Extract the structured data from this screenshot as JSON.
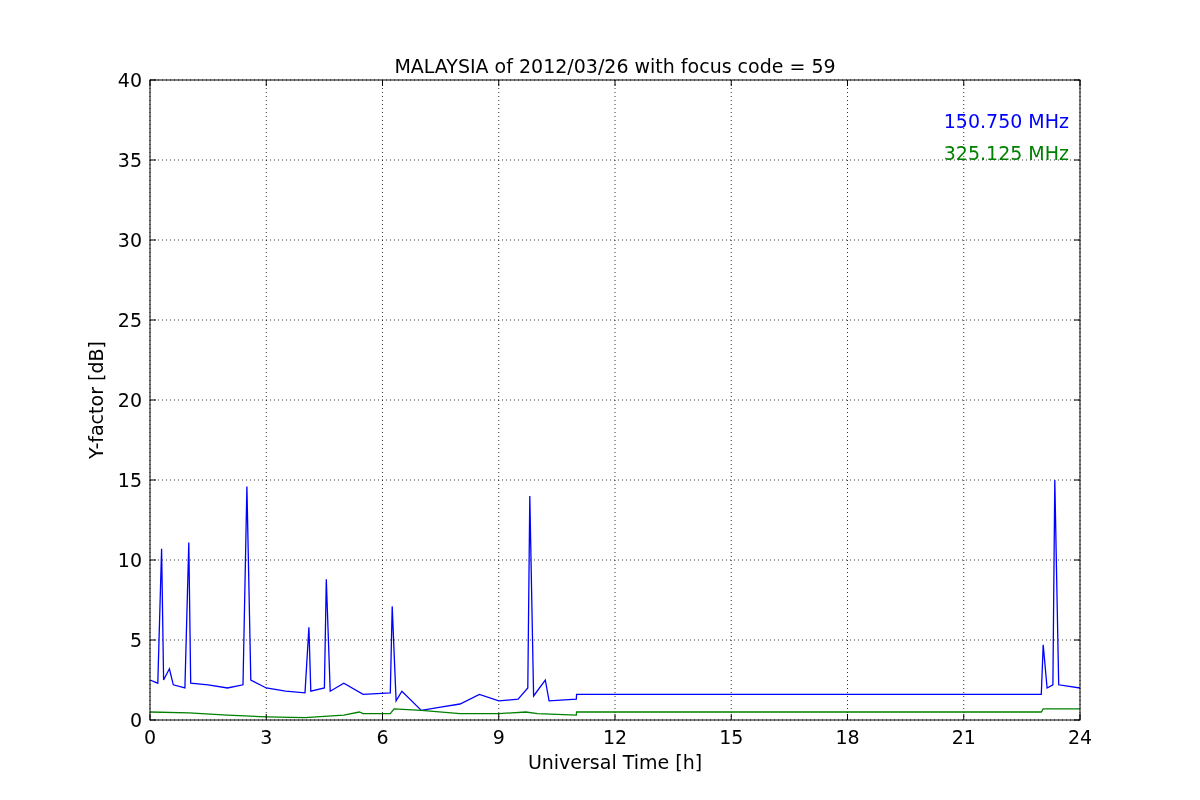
{
  "chart_data": {
    "type": "line",
    "title": "MALAYSIA of 2012/03/26 with focus code = 59",
    "xlabel": "Universal Time [h]",
    "ylabel": "Y-factor [dB]",
    "xlim": [
      0,
      24
    ],
    "ylim": [
      0,
      40
    ],
    "xticks": [
      0,
      3,
      6,
      9,
      12,
      15,
      18,
      21,
      24
    ],
    "yticks": [
      0,
      5,
      10,
      15,
      20,
      25,
      30,
      35,
      40
    ],
    "grid": true,
    "series": [
      {
        "name": "150.750 MHz",
        "color": "#0000ff",
        "x": [
          0,
          0.2,
          0.3,
          0.35,
          0.5,
          0.6,
          0.9,
          1.0,
          1.05,
          1.5,
          2.0,
          2.4,
          2.5,
          2.6,
          3.0,
          3.5,
          4.0,
          4.1,
          4.15,
          4.5,
          4.55,
          4.65,
          5.0,
          5.5,
          6.2,
          6.25,
          6.35,
          6.5,
          7.0,
          7.5,
          8.0,
          8.5,
          9.0,
          9.5,
          9.75,
          9.8,
          9.9,
          10.2,
          10.3,
          11.0,
          11.01,
          23.0,
          23.05,
          23.15,
          23.3,
          23.35,
          23.45,
          24
        ],
        "values": [
          2.5,
          2.3,
          10.7,
          2.5,
          3.2,
          2.2,
          2.0,
          11.1,
          2.3,
          2.2,
          2.0,
          2.2,
          14.6,
          2.5,
          2.0,
          1.8,
          1.7,
          5.8,
          1.8,
          2.0,
          8.8,
          1.8,
          2.3,
          1.6,
          1.7,
          7.1,
          1.2,
          1.8,
          0.6,
          0.8,
          1.0,
          1.6,
          1.2,
          1.3,
          2.0,
          14.0,
          1.5,
          2.5,
          1.2,
          1.3,
          1.6,
          1.6,
          4.7,
          2.0,
          2.2,
          15.0,
          2.2,
          2.0
        ]
      },
      {
        "name": "325.125 MHz",
        "color": "#008000",
        "x": [
          0,
          1,
          2,
          3,
          4,
          5,
          5.4,
          5.5,
          6.2,
          6.3,
          7,
          8,
          9,
          9.7,
          10,
          11,
          11.01,
          23,
          23.05,
          24
        ],
        "values": [
          0.5,
          0.45,
          0.3,
          0.2,
          0.15,
          0.3,
          0.5,
          0.4,
          0.4,
          0.7,
          0.6,
          0.4,
          0.4,
          0.5,
          0.4,
          0.3,
          0.5,
          0.5,
          0.7,
          0.7
        ]
      }
    ]
  }
}
